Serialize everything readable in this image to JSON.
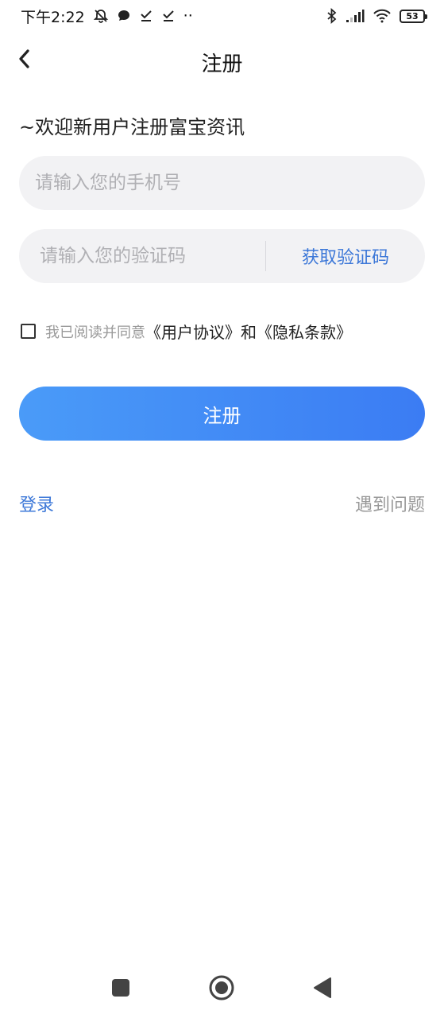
{
  "status_bar": {
    "time": "下午2:22",
    "dots": "··",
    "battery": "53"
  },
  "nav": {
    "title": "注册"
  },
  "welcome": "~欢迎新用户注册富宝资讯",
  "phone_input": {
    "value": "",
    "placeholder": "请输入您的手机号"
  },
  "code_input": {
    "value": "",
    "placeholder": "请输入您的验证码"
  },
  "get_code_label": "获取验证码",
  "agreement": {
    "checked": false,
    "prefix": "我已阅读并同意",
    "user_agreement": "《用户协议》",
    "and": "和",
    "privacy_policy": "《隐私条款》"
  },
  "register_label": "注册",
  "login_label": "登录",
  "help_label": "遇到问题",
  "colors": {
    "accent": "#3d78d8",
    "button_start": "#4a9bf8",
    "button_end": "#3b7cf3",
    "field_bg": "#f2f2f4"
  },
  "icons": {
    "back": "chevron-left-icon",
    "recent": "square-icon",
    "home": "circle-icon",
    "sys_back": "triangle-left-icon"
  }
}
